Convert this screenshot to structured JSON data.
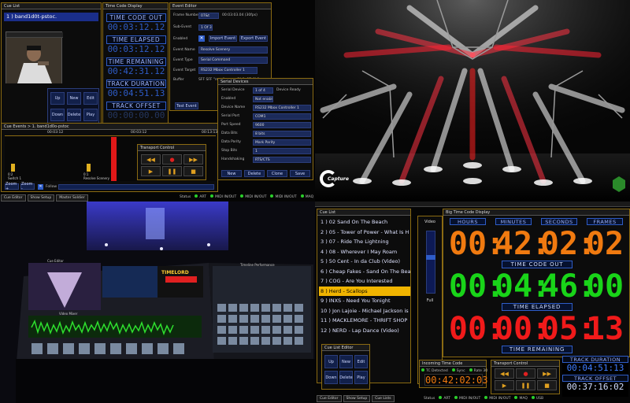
{
  "q1": {
    "cue_list_title": "Cue List",
    "cue_item": "1 ) band1d0t-pstoc.",
    "timecode_title": "Time Code Display",
    "labels": [
      "TIME CODE OUT",
      "TIME ELAPSED",
      "TIME REMAINING",
      "TRACK DURATION",
      "TRACK OFFSET"
    ],
    "values": [
      "00:03:12.12",
      "00:03:12.12",
      "00:42:31.12",
      "00:04:51.13",
      "00:00:00.00"
    ],
    "event_editor_title": "Event Editor",
    "frame_number_label": "Frame Number",
    "frame_number": "07&t",
    "frame_rate": "00:03:03.04 (30fps)",
    "sub_event_label": "Sub-Event",
    "sub_event": "1 Of 3",
    "enabled_label": "Enabled",
    "import_event": "Import Event",
    "export_event": "Export Event",
    "event_name_label": "Event Name",
    "event_name": "Resolve Scenery",
    "event_type_label": "Event Type",
    "event_type": "Serial Command",
    "event_target_label": "Event Target",
    "event_target": "RS232 Mbox Controller 1",
    "buffer_label": "Buffer",
    "buffer": "SFF SFF \"recall scene 1\" 0x0D 0L0",
    "test_event": "Test Event",
    "serial_title": "Serial Devices",
    "serial_rows": [
      [
        "Serial Device",
        "1 of 4"
      ],
      [
        "Enabled",
        "Not enabled"
      ],
      [
        "Device Name",
        "RS232 Mbox Controller 1"
      ],
      [
        "Serial Port",
        "COM1"
      ],
      [
        "Port Speed",
        "9600"
      ],
      [
        "Data Bits",
        "8 bits"
      ],
      [
        "Data Parity",
        "Mark Parity"
      ],
      [
        "Stop Bits",
        "1"
      ],
      [
        "Handshaking",
        "RTS/CTS"
      ]
    ],
    "device_ready": "Device Ready",
    "serial_buttons": [
      "New",
      "Delete",
      "Clone",
      "Save"
    ],
    "cue_buttons": [
      "Up",
      "New",
      "Edit",
      "Down",
      "Delete",
      "Play"
    ],
    "cue_events_title": "Cue Events > 1. band1d0o-pstoc",
    "ruler_times": [
      "00:03:12",
      "00:03:12",
      "00:13:13"
    ],
    "markers": [
      "0:2\nSwitch 1",
      "0:1\nResolve Scenery"
    ],
    "zoom_controls": [
      "Zoom +",
      "Zoom -",
      "Follow"
    ],
    "transport_title": "Transport Control",
    "status_items": [
      "Status",
      "ART",
      "MIDI IN/OUT",
      "MIDI IN/OUT",
      "MIDI IN/OUT",
      "MAQ",
      "USB"
    ],
    "tabs": [
      "Cue Editor",
      "Show Setup",
      "Master Soldier"
    ]
  },
  "q2": {
    "logo_text": "Capture"
  },
  "q3": {
    "console_panels": [
      "Cue Editor",
      "Video Mixer",
      "Timeline Performance"
    ],
    "console_brand": "TIMELORD"
  },
  "q4": {
    "cue_list_title": "Cue List",
    "cues": [
      "1 ) 02 Sand On The Beach",
      "2 ) 05 - Tower of Power - What Is H",
      "3 ) 07 - Ride The Lightning",
      "4 ) 08 - Wherever I May Roam",
      "5 ) 50 Cent - In da Club (Video)",
      "6 ) Cheap Fakes - Sand On The Beac",
      "7 ) COG - Are You Interested",
      "8 ) Herd - Scallops",
      "9 ) INXS - Need You Tonight",
      "10 ) Jon Lajoie - Michael Jackson is",
      "11 ) MACKLEMORE - THRIFT SHOP",
      "12 ) NERD - Lap Dance (Video)"
    ],
    "selected_index": 7,
    "video_label": "Video",
    "full_label": "Full",
    "bigdisp_title": "Big Time Code Display",
    "headers": [
      "HOURS",
      "MINUTES",
      "SECONDS",
      "FRAMES"
    ],
    "rows": [
      {
        "digits": [
          "00",
          "42",
          "02",
          "02"
        ],
        "label": "TIME CODE OUT",
        "color": "#f07a10"
      },
      {
        "digits": [
          "00",
          "04",
          "46",
          "00"
        ],
        "label": "TIME ELAPSED",
        "color": "#19d419"
      },
      {
        "digits": [
          "00",
          "00",
          "05",
          "13"
        ],
        "label": "TIME REMAINING",
        "color": "#f01a1a"
      }
    ],
    "cue_editor_title": "Cue List Editor",
    "cue_buttons": [
      "Up",
      "New",
      "Edit",
      "Down",
      "Delete",
      "Play"
    ],
    "incoming_title": "Incoming Time Code",
    "tc_detected": "TC Detected",
    "sync": "Sync",
    "rate_label": "Rate",
    "rate": "30",
    "incoming_value": "00:42:02:03",
    "transport_title": "Transport Control",
    "track_duration_label": "TRACK DURATION",
    "track_duration": "00:04:51:13",
    "track_offset_label": "TRACK OFFSET",
    "track_offset": "00:37:16:02",
    "tabs": [
      "Cue Editor",
      "Show Setup",
      "Cue Lists"
    ],
    "status_items": [
      "Status",
      "ART",
      "MIDI IN/OUT",
      "MIDI IN/OUT",
      "MAQ",
      "USB"
    ]
  }
}
